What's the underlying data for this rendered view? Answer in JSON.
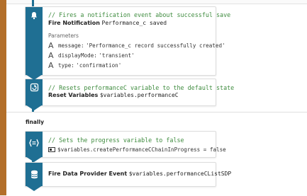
{
  "notification_card": {
    "comment": "// Fires a notification event about successful save",
    "action_name": "Fire Notification",
    "action_target": "Performance_c saved",
    "params_label": "Parameters",
    "params": [
      {
        "key": "message:",
        "value": "'Performance_c record successfully created'"
      },
      {
        "key": "displayMode:",
        "value": "'transient'"
      },
      {
        "key": "type:",
        "value": "'confirmation'"
      }
    ]
  },
  "reset_card": {
    "comment": "// Resets performanceC variable to the default state",
    "action_name": "Reset Variables",
    "action_target": "$variables.performanceC"
  },
  "finally_label": "finally",
  "assign_card": {
    "comment": "// Sets the progress variable to false",
    "assignment": "$variables.createPerformanceCChainInProgress = false"
  },
  "dataprovider_card": {
    "action_name": "Fire Data Provider Event",
    "action_target": "$variables.performanceCListSDP"
  },
  "colors": {
    "accent": "#1f6f93",
    "try_bar": "#b36f2a",
    "comment": "#3f8c3f"
  }
}
